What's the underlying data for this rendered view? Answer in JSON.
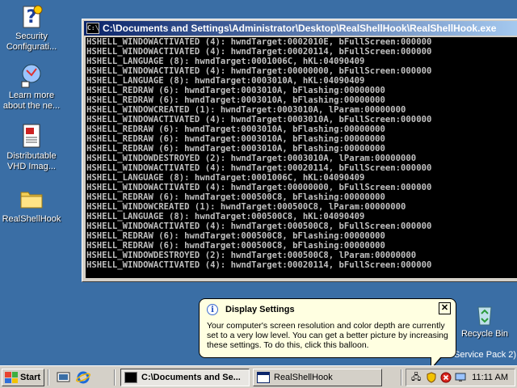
{
  "desktop": {
    "icons": [
      {
        "label": "Security Configurati...",
        "icon": "security-config-icon"
      },
      {
        "label": "Learn more about the ne...",
        "icon": "learn-more-icon"
      },
      {
        "label": "Distributable VHD Imag...",
        "icon": "document-icon"
      },
      {
        "label": "RealShellHook",
        "icon": "folder-icon"
      }
    ],
    "recycle_bin": {
      "label": "Recycle Bin",
      "icon": "recycle-bin-icon"
    },
    "watermark_text": "Service Pack 2)"
  },
  "console": {
    "title": "C:\\Documents and Settings\\Administrator\\Desktop\\RealShellHook\\RealShellHook.exe",
    "lines": [
      "HSHELL_WINDOWACTIVATED (4): hwndTarget:0002010E, bFullScreen:000000",
      "HSHELL_WINDOWACTIVATED (4): hwndTarget:00020114, bFullScreen:000000",
      "HSHELL_LANGUAGE (8): hwndTarget:0001006C, hKL:04090409",
      "HSHELL_WINDOWACTIVATED (4): hwndTarget:00000000, bFullScreen:000000",
      "HSHELL_LANGUAGE (8): hwndTarget:0003010A, hKL:04090409",
      "HSHELL_REDRAW (6): hwndTarget:0003010A, bFlashing:00000000",
      "HSHELL_REDRAW (6): hwndTarget:0003010A, bFlashing:00000000",
      "HSHELL_WINDOWCREATED (1): hwndTarget:0003010A, lParam:00000000",
      "HSHELL_WINDOWACTIVATED (4): hwndTarget:0003010A, bFullScreen:000000",
      "HSHELL_REDRAW (6): hwndTarget:0003010A, bFlashing:00000000",
      "HSHELL_REDRAW (6): hwndTarget:0003010A, bFlashing:00000000",
      "HSHELL_REDRAW (6): hwndTarget:0003010A, bFlashing:00000000",
      "HSHELL_WINDOWDESTROYED (2): hwndTarget:0003010A, lParam:00000000",
      "HSHELL_WINDOWACTIVATED (4): hwndTarget:00020114, bFullScreen:000000",
      "HSHELL_LANGUAGE (8): hwndTarget:0001006C, hKL:04090409",
      "HSHELL_WINDOWACTIVATED (4): hwndTarget:00000000, bFullScreen:000000",
      "HSHELL_REDRAW (6): hwndTarget:000500C8, bFlashing:00000000",
      "HSHELL_WINDOWCREATED (1): hwndTarget:000500C8, lParam:00000000",
      "HSHELL_LANGUAGE (8): hwndTarget:000500C8, hKL:04090409",
      "HSHELL_WINDOWACTIVATED (4): hwndTarget:000500C8, bFullScreen:000000",
      "HSHELL_REDRAW (6): hwndTarget:000500C8, bFlashing:00000000",
      "HSHELL_REDRAW (6): hwndTarget:000500C8, bFlashing:00000000",
      "HSHELL_WINDOWDESTROYED (2): hwndTarget:000500C8, lParam:00000000",
      "HSHELL_WINDOWACTIVATED (4): hwndTarget:00020114, bFullScreen:000000"
    ]
  },
  "balloon": {
    "title": "Display Settings",
    "text": "Your computer's screen resolution and color depth are currently set to a very low level. You can get a better picture by increasing these settings. To do this, click this balloon.",
    "close_label": "✕"
  },
  "taskbar": {
    "start_label": "Start",
    "tasks": [
      {
        "label": "C:\\Documents and Se...",
        "active": true
      },
      {
        "label": "RealShellHook",
        "active": false
      }
    ],
    "clock": "11:11 AM"
  },
  "colors": {
    "desktop": "#3a6ea5",
    "title_active_start": "#0a246a",
    "title_active_end": "#a6caf0",
    "balloon_bg": "#ffffe1"
  }
}
